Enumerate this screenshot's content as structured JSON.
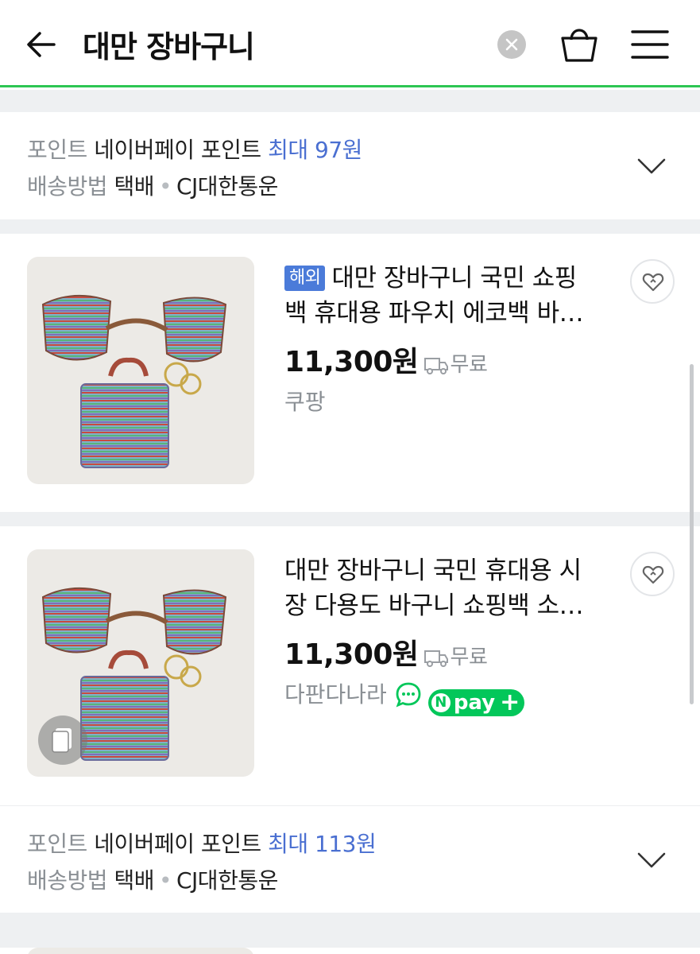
{
  "header": {
    "search_query": "대만 장바구니"
  },
  "info_rows": [
    {
      "point_label": "포인트",
      "point_name": "네이버페이 포인트",
      "point_value": "최대 97원",
      "delivery_label": "배송방법",
      "delivery_method": "택배",
      "courier": "CJ대한통운"
    },
    {
      "point_label": "포인트",
      "point_name": "네이버페이 포인트",
      "point_value": "최대 113원",
      "delivery_label": "배송방법",
      "delivery_method": "택배",
      "courier": "CJ대한통운"
    }
  ],
  "products": [
    {
      "badge": "해외",
      "title_line1": "대만 장바구니 국민 쇼핑",
      "title_line2": "백 휴대용 파우치 에코백 바…",
      "price": "11,300원",
      "shipping": "무료",
      "mall": "쿠팡"
    },
    {
      "badge": "",
      "title_line1": "대만 장바구니 국민 휴대용 시",
      "title_line2": "장 다용도 바구니 쇼핑백 소…",
      "price": "11,300원",
      "shipping": "무료",
      "mall": "다판다나라",
      "npay_label": "pay",
      "npay_n": "N"
    }
  ],
  "colors": {
    "accent_green": "#2dc653",
    "point_blue": "#4a6fd1",
    "badge_blue": "#4b7bd9",
    "npay_green": "#03c75a"
  }
}
